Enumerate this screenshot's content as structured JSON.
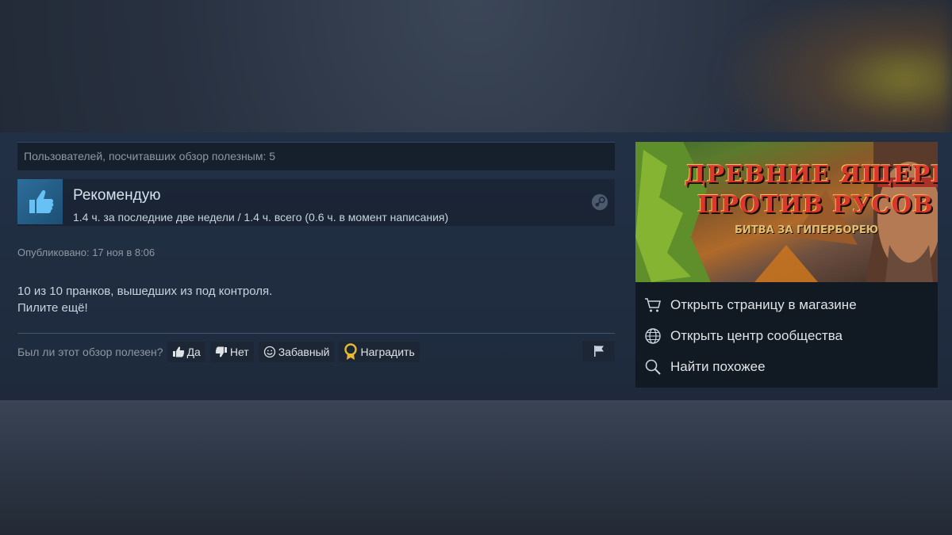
{
  "review": {
    "helpful_count_text": "Пользователей, посчитавших обзор полезным: 5",
    "recommendation": "Рекомендую",
    "hours_text": "1.4 ч. за последние две недели / 1.4 ч. всего (0.6 ч. в момент написания)",
    "published": "Опубликовано: 17 ноя в 8:06",
    "text_lines": [
      "10 из 10 пранков, вышедших из под контроля.",
      "Пилите ещё!"
    ]
  },
  "vote": {
    "question": "Был ли этот обзор полезен?",
    "yes_label": "Да",
    "no_label": "Нет",
    "funny_label": "Забавный",
    "award_label": "Наградить"
  },
  "game_banner": {
    "title_line1": "ДРЕВНИЕ ЯЩЕРЫ",
    "title_line2": "ПРОТИВ РУСОВ",
    "subtitle": "БИТВА ЗА ГИПЕРБОРЕЮ"
  },
  "side_links": {
    "store": "Открыть страницу в магазине",
    "community": "Открыть центр сообщества",
    "similar": "Найти похожее"
  },
  "colors": {
    "panel": "#1e2a3c",
    "accent_blue": "#2d6e9a",
    "award_gold": "#e5b933",
    "banner_title": "#d8392a"
  },
  "icons": [
    "thumbs-up-icon",
    "steam-icon",
    "thumbs-down-icon",
    "smiley-icon",
    "award-icon",
    "flag-icon",
    "cart-icon",
    "globe-icon",
    "search-icon"
  ]
}
